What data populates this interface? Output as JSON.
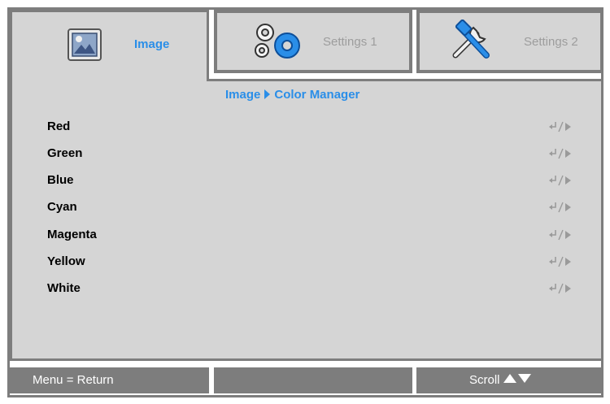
{
  "tabs": [
    {
      "label": "Image",
      "icon": "image-icon",
      "active": true
    },
    {
      "label": "Settings 1",
      "icon": "gears-icon",
      "active": false
    },
    {
      "label": "Settings 2",
      "icon": "tools-icon",
      "active": false
    }
  ],
  "breadcrumb": {
    "parent": "Image",
    "current": "Color Manager"
  },
  "menu": {
    "items": [
      {
        "label": "Red",
        "action_icon": "enter-right-icon"
      },
      {
        "label": "Green",
        "action_icon": "enter-right-icon"
      },
      {
        "label": "Blue",
        "action_icon": "enter-right-icon"
      },
      {
        "label": "Cyan",
        "action_icon": "enter-right-icon"
      },
      {
        "label": "Magenta",
        "action_icon": "enter-right-icon"
      },
      {
        "label": "Yellow",
        "action_icon": "enter-right-icon"
      },
      {
        "label": "White",
        "action_icon": "enter-right-icon"
      }
    ]
  },
  "footer": {
    "left": "Menu = Return",
    "middle": "",
    "right": "Scroll"
  },
  "colors": {
    "accent": "#2a8ee8",
    "border": "#7d7d7d",
    "panel": "#d5d5d5",
    "inactive_text": "#9d9d9d"
  }
}
